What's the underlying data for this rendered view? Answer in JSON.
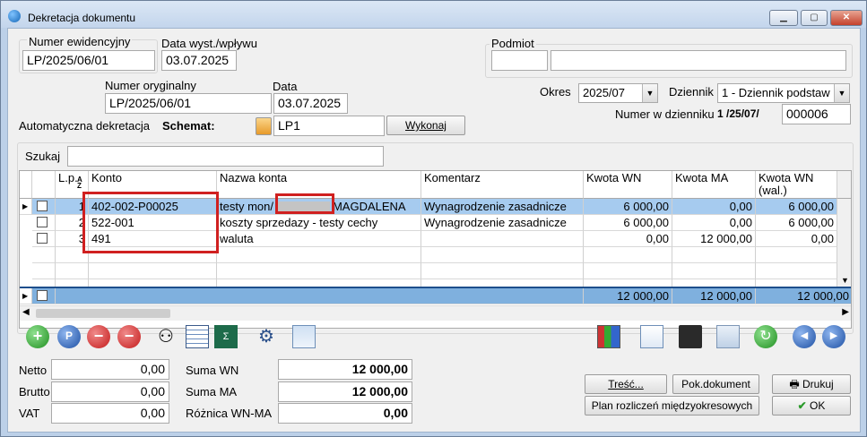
{
  "window": {
    "title": "Dekretacja dokumentu"
  },
  "header": {
    "numer_ewidencyjny_label": "Numer ewidencyjny",
    "numer_ewidencyjny": "LP/2025/06/01",
    "data_wyst_label": "Data wyst./wpływu",
    "data_wyst": "03.07.2025",
    "podmiot_label": "Podmiot",
    "numer_oryginalny_label": "Numer oryginalny",
    "numer_oryginalny": "LP/2025/06/01",
    "data_label": "Data",
    "data": "03.07.2025",
    "okres_label": "Okres",
    "okres": "2025/07",
    "dziennik_label": "Dziennik",
    "dziennik": "1 - Dziennik podstaw",
    "numer_w_dzienniku_label": "Numer w dzienniku",
    "numer_w_dzienniku_prefix": "1 /25/07/",
    "numer_w_dzienniku": "000006",
    "auto_label": "Automatyczna dekretacja",
    "schemat_label": "Schemat:",
    "schemat": "LP1",
    "wykonaj": "Wykonaj"
  },
  "search": {
    "label": "Szukaj"
  },
  "grid": {
    "columns": [
      "L.p.",
      "Konto",
      "Nazwa konta",
      "Komentarz",
      "Kwota WN",
      "Kwota MA",
      "Kwota WN (wal.)"
    ],
    "sort_icon": "AZ",
    "rows": [
      {
        "lp": "1",
        "konto": "402-002-P00025",
        "nazwa": "testy mon/",
        "nazwa2": "MAGDALENA",
        "komentarz": "Wynagrodzenie zasadnicze",
        "wn": "6 000,00",
        "ma": "0,00",
        "wnwal": "6 000,00"
      },
      {
        "lp": "2",
        "konto": "522-001",
        "nazwa": "koszty sprzedazy - testy cechy",
        "nazwa2": "",
        "komentarz": "Wynagrodzenie zasadnicze",
        "wn": "6 000,00",
        "ma": "0,00",
        "wnwal": "6 000,00"
      },
      {
        "lp": "3",
        "konto": "491",
        "nazwa": "waluta",
        "nazwa2": "",
        "komentarz": "",
        "wn": "0,00",
        "ma": "12 000,00",
        "wnwal": "0,00"
      }
    ],
    "totals": {
      "wn": "12 000,00",
      "ma": "12 000,00",
      "wnwal": "12 000,00"
    }
  },
  "summary": {
    "netto_label": "Netto",
    "netto": "0,00",
    "brutto_label": "Brutto",
    "brutto": "0,00",
    "vat_label": "VAT",
    "vat": "0,00",
    "suma_wn_label": "Suma WN",
    "suma_wn": "12 000,00",
    "suma_ma_label": "Suma MA",
    "suma_ma": "12 000,00",
    "roznica_label": "Różnica WN-MA",
    "roznica": "0,00"
  },
  "buttons": {
    "tresc": "Treść...",
    "pok": "Pok.dokument",
    "drukuj": "Drukuj",
    "plan": "Plan rozliczeń międzyokresowych",
    "ok": "OK"
  },
  "toolbar": {
    "icons": [
      "add-icon",
      "preview-icon",
      "delete-icon",
      "remove-check-icon",
      "binoculars-icon",
      "calendar-icon",
      "formula-icon",
      "network-icon",
      "chart-window-icon"
    ],
    "right_icons": [
      "report-icon",
      "document-icon",
      "save-icon",
      "copy-icon",
      "refresh-icon",
      "first-icon",
      "last-icon"
    ]
  },
  "colors": {
    "selected": "#a6cbef",
    "totals": "#7fb0de",
    "highlight": "#d02020"
  }
}
